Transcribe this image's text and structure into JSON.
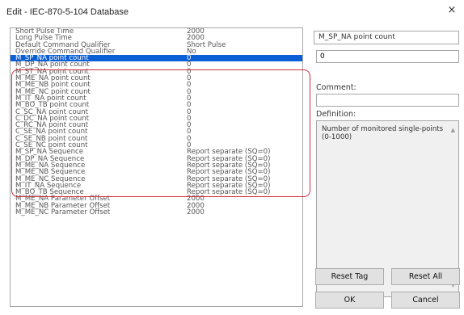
{
  "window": {
    "title": "Edit - IEC-870-5-104 Database",
    "close_glyph": "×"
  },
  "list": {
    "rows": [
      {
        "name": "Short Pulse Time",
        "value": "2000"
      },
      {
        "name": "Long Pulse Time",
        "value": "2000"
      },
      {
        "name": "Default Command Qualifier",
        "value": "Short Pulse"
      },
      {
        "name": "Override Command Qualifier",
        "value": "No"
      },
      {
        "name": "M_SP_NA point count",
        "value": "0",
        "selected": true
      },
      {
        "name": "M_DP_NA point count",
        "value": "0"
      },
      {
        "name": "M_ST_NA point count",
        "value": "0"
      },
      {
        "name": "M_ME_NA point count",
        "value": "0"
      },
      {
        "name": "M_ME_NB point count",
        "value": "0"
      },
      {
        "name": "M_ME_NC point count",
        "value": "0"
      },
      {
        "name": "M_IT_NA point count",
        "value": "0"
      },
      {
        "name": "M_BO_TB point count",
        "value": "0"
      },
      {
        "name": "C_SC_NA point count",
        "value": "0"
      },
      {
        "name": "C_DC_NA point count",
        "value": "0"
      },
      {
        "name": "C_RC_NA point count",
        "value": "0"
      },
      {
        "name": "C_SE_NA point count",
        "value": "0"
      },
      {
        "name": "C_SE_NB point count",
        "value": "0"
      },
      {
        "name": "C_SE_NC point count",
        "value": "0"
      },
      {
        "name": "M_SP_NA Sequence",
        "value": "Report separate (SQ=0)"
      },
      {
        "name": "M_DP_NA Sequence",
        "value": "Report separate (SQ=0)"
      },
      {
        "name": "M_ME_NA Sequence",
        "value": "Report separate (SQ=0)"
      },
      {
        "name": "M_ME_NB Sequence",
        "value": "Report separate (SQ=0)"
      },
      {
        "name": "M_ME_NC Sequence",
        "value": "Report separate (SQ=0)"
      },
      {
        "name": "M_IT_NA Sequence",
        "value": "Report separate (SQ=0)"
      },
      {
        "name": "M_BO_TB Sequence",
        "value": "Report separate (SQ=0)"
      },
      {
        "name": "M_ME_NA Parameter Offset",
        "value": "2000"
      },
      {
        "name": "M_ME_NB Parameter Offset",
        "value": "2000"
      },
      {
        "name": "M_ME_NC Parameter Offset",
        "value": "2000"
      }
    ]
  },
  "editor": {
    "tag_name": "M_SP_NA point count",
    "value": "0",
    "comment_label": "Comment:",
    "comment_value": "",
    "definition_label": "Definition:",
    "definition_text": "Number of monitored single-points (0-1000)",
    "scroll_up_glyph": "▲",
    "scroll_down_glyph": "▼"
  },
  "buttons": {
    "reset_tag": "Reset Tag",
    "reset_all": "Reset All",
    "ok": "OK",
    "cancel": "Cancel"
  },
  "colors": {
    "selection": "#0a5fd6",
    "annotation": "#cf2b3f"
  }
}
